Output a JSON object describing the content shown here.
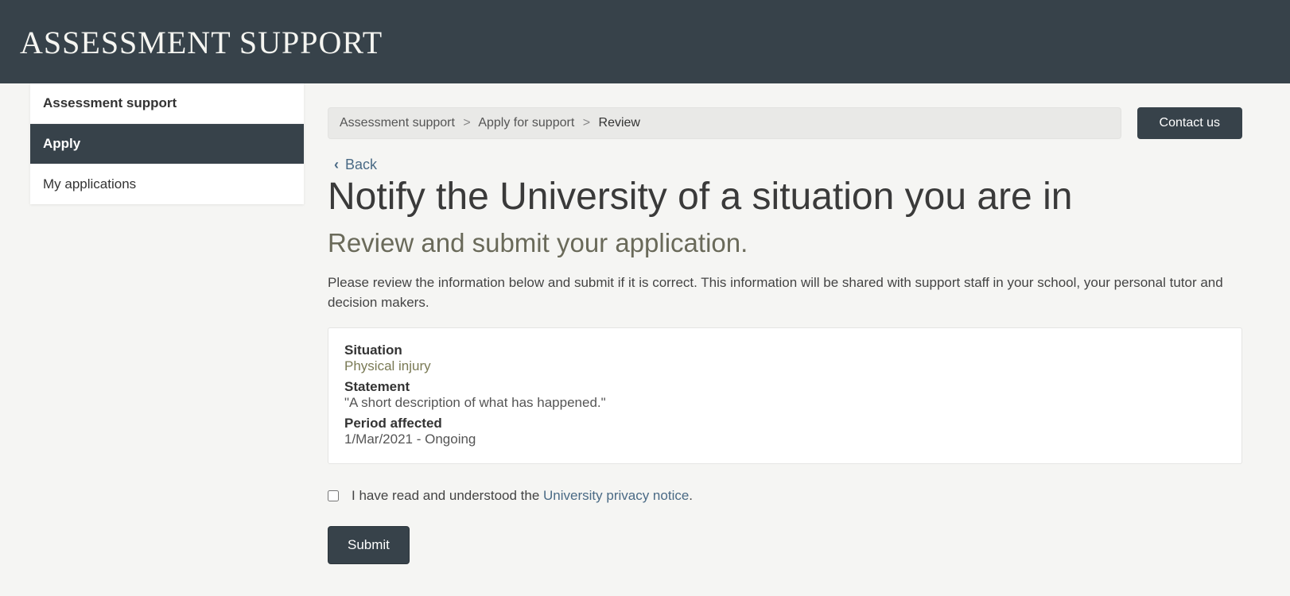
{
  "header": {
    "title": "ASSESSMENT SUPPORT"
  },
  "sidebar": {
    "items": [
      {
        "label": "Assessment support",
        "type": "header"
      },
      {
        "label": "Apply",
        "active": true
      },
      {
        "label": "My applications"
      }
    ]
  },
  "breadcrumb": {
    "items": [
      "Assessment support",
      "Apply for support",
      "Review"
    ]
  },
  "contact_button": "Contact us",
  "back": {
    "label": "Back"
  },
  "page": {
    "title": "Notify the University of a situation you are in",
    "subtitle": "Review and submit your application.",
    "description": "Please review the information below and submit if it is correct. This information will be shared with support staff in your school, your personal tutor and decision makers."
  },
  "review": {
    "situation_label": "Situation",
    "situation_value": "Physical injury",
    "statement_label": "Statement",
    "statement_value": "\"A short description of what has happened.\"",
    "period_label": "Period affected",
    "period_value": "1/Mar/2021 - Ongoing"
  },
  "consent": {
    "text_before_link": "I have read and understood the ",
    "link_text": "University privacy notice",
    "text_after_link": "."
  },
  "submit_button": "Submit"
}
